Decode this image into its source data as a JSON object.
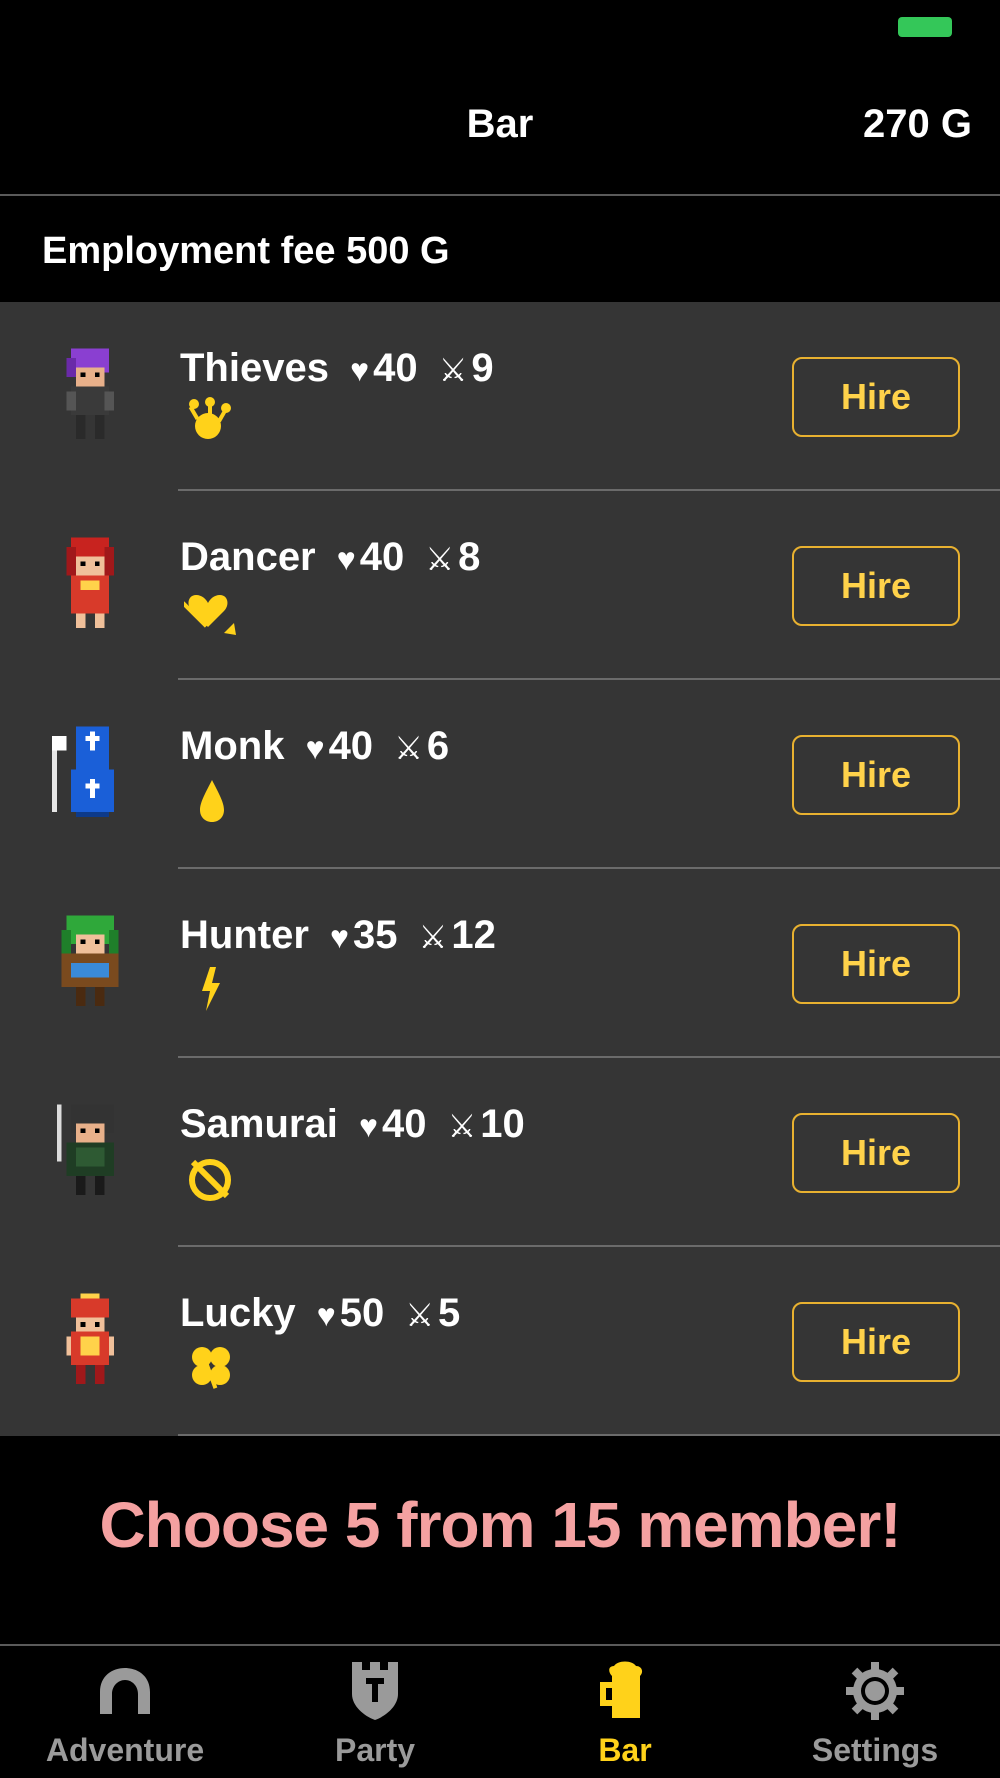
{
  "header": {
    "title": "Bar",
    "gold": "270 G"
  },
  "section": {
    "title": "Employment fee 500 G"
  },
  "symbols": {
    "hp": "♥",
    "atk": "⚔"
  },
  "members": [
    {
      "name": "Thieves",
      "hp": "40",
      "atk": "9",
      "skill_icon": "crown-icon",
      "button": "Hire"
    },
    {
      "name": "Dancer",
      "hp": "40",
      "atk": "8",
      "skill_icon": "heart-arrow-icon",
      "button": "Hire"
    },
    {
      "name": "Monk",
      "hp": "40",
      "atk": "6",
      "skill_icon": "drop-icon",
      "button": "Hire"
    },
    {
      "name": "Hunter",
      "hp": "35",
      "atk": "12",
      "skill_icon": "lightning-icon",
      "button": "Hire"
    },
    {
      "name": "Samurai",
      "hp": "40",
      "atk": "10",
      "skill_icon": "slash-circle-icon",
      "button": "Hire"
    },
    {
      "name": "Lucky",
      "hp": "50",
      "atk": "5",
      "skill_icon": "clover-icon",
      "button": "Hire"
    }
  ],
  "banner": {
    "text": "Choose 5 from 15 member!"
  },
  "tabs": [
    {
      "label": "Adventure",
      "icon": "arch-icon",
      "active": false
    },
    {
      "label": "Party",
      "icon": "shield-tower-icon",
      "active": false
    },
    {
      "label": "Bar",
      "icon": "beer-mug-icon",
      "active": true
    },
    {
      "label": "Settings",
      "icon": "gear-icon",
      "active": false
    }
  ],
  "colors": {
    "accent": "#ffd21a",
    "button_border": "#e8b130",
    "banner_text": "#f4a1a1",
    "row_bg": "#353535",
    "inactive_tab": "#9a9a9a",
    "battery": "#34c759"
  }
}
